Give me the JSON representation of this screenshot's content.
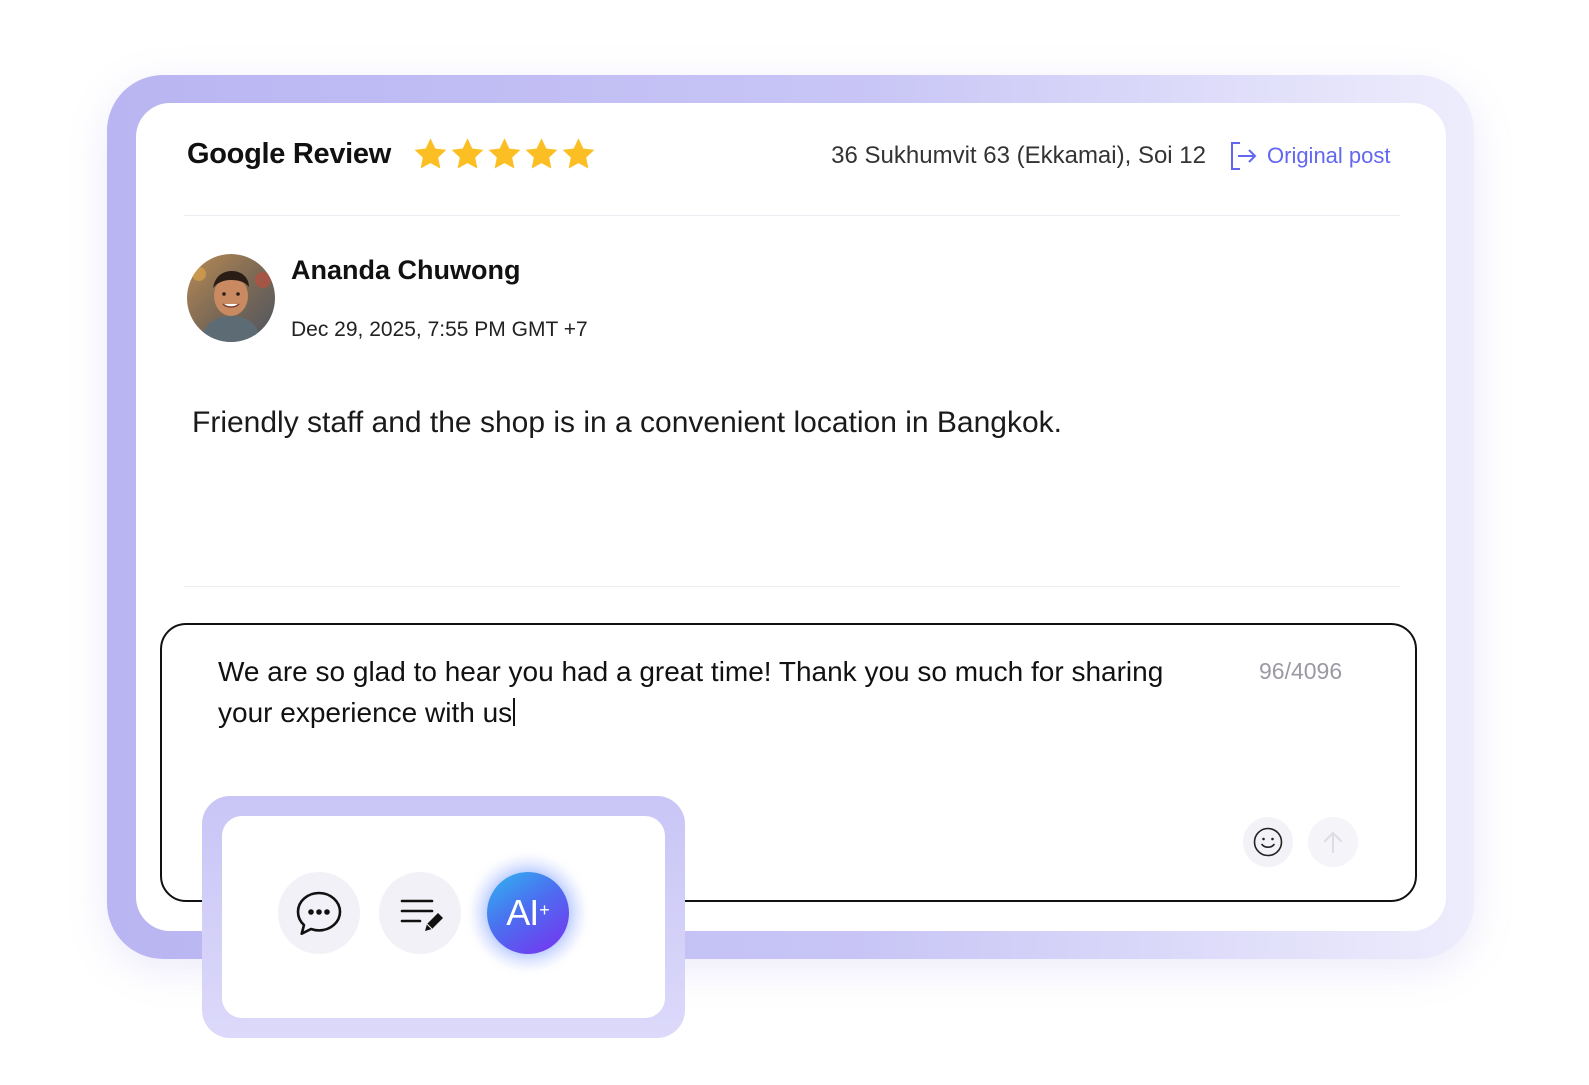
{
  "review": {
    "source_title": "Google Review",
    "rating": 5,
    "location": "36 Sukhumvit 63 (Ekkamai), Soi 12",
    "original_post_label": "Original post",
    "author": "Ananda Chuwong",
    "date": "Dec 29, 2025, 7:55 PM GMT +7",
    "text": "Friendly staff and the shop is in a convenient location in Bangkok."
  },
  "reply": {
    "text": "We are so glad to hear you had a great time! Thank you so much for sharing your experience with us",
    "counter": "96/4096"
  },
  "toolbar": {
    "ai_label": "AI",
    "ai_plus": "+"
  },
  "colors": {
    "star": "#fbbf24",
    "accent": "#6366f1",
    "frame": "#b9b5f2"
  },
  "icons": [
    "star-icon",
    "external-link-icon",
    "emoji-icon",
    "send-arrow-icon",
    "chat-bubble-icon",
    "edit-lines-icon",
    "ai-plus-icon"
  ]
}
